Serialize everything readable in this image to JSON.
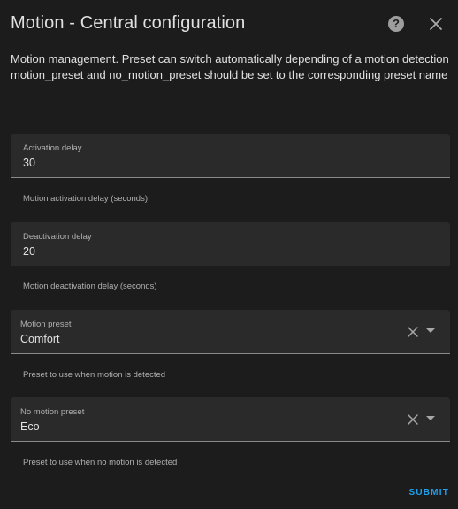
{
  "dialog": {
    "title": "Motion - Central configuration",
    "help_icon": "help-circle-icon",
    "close_icon": "close-icon",
    "description_line1": "Motion management. Preset can switch automatically depending of a motion detection",
    "description_line2": "motion_preset and no_motion_preset should be set to the corresponding preset name"
  },
  "fields": {
    "activation_delay": {
      "label": "Activation delay",
      "value": "30",
      "helper": "Motion activation delay (seconds)"
    },
    "deactivation_delay": {
      "label": "Deactivation delay",
      "value": "20",
      "helper": "Motion deactivation delay (seconds)"
    },
    "motion_preset": {
      "label": "Motion preset",
      "value": "Comfort",
      "helper": "Preset to use when motion is detected"
    },
    "no_motion_preset": {
      "label": "No motion preset",
      "value": "Eco",
      "helper": "Preset to use when no motion is detected"
    }
  },
  "actions": {
    "submit_label": "SUBMIT"
  },
  "colors": {
    "background": "#1c1c1c",
    "field_background": "#2a2a2a",
    "accent": "#1e9fef",
    "text": "#e1e1e1",
    "secondary_text": "#b0b0b0"
  }
}
